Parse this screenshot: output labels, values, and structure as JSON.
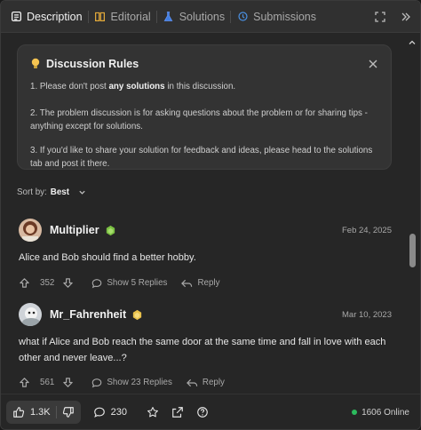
{
  "tabs": [
    {
      "label": "Description",
      "icon": "description-icon"
    },
    {
      "label": "Editorial",
      "icon": "book-icon"
    },
    {
      "label": "Solutions",
      "icon": "flask-icon"
    },
    {
      "label": "Submissions",
      "icon": "history-icon"
    }
  ],
  "rules": {
    "title": "Discussion Rules",
    "rule1_pre": "1. Please don't post ",
    "rule1_bold": "any solutions",
    "rule1_post": " in this discussion.",
    "rule2": "2. The problem discussion is for asking questions about the problem or for sharing tips - anything except for solutions.",
    "rule3": "3. If you'd like to share your solution for feedback and ideas, please head to the solutions tab and post it there."
  },
  "sort": {
    "label": "Sort by:",
    "value": "Best"
  },
  "comments": [
    {
      "user": "Multiplier",
      "date": "Feb 24, 2025",
      "body": "Alice and Bob should find a better hobby.",
      "votes": "352",
      "replies": "Show 5 Replies",
      "reply_label": "Reply"
    },
    {
      "user": "Mr_Fahrenheit",
      "date": "Mar 10, 2023",
      "body": "what if Alice and Bob reach the same door at the same time and fall in love with each other and never leave...?",
      "votes": "561",
      "replies": "Show 23 Replies",
      "reply_label": "Reply"
    }
  ],
  "bottom": {
    "likes": "1.3K",
    "comments": "230",
    "online": "1606 Online"
  },
  "colors": {
    "online_dot": "#2cbb5d",
    "badge_green": "#7bc043",
    "badge_gold": "#e8c04a"
  }
}
